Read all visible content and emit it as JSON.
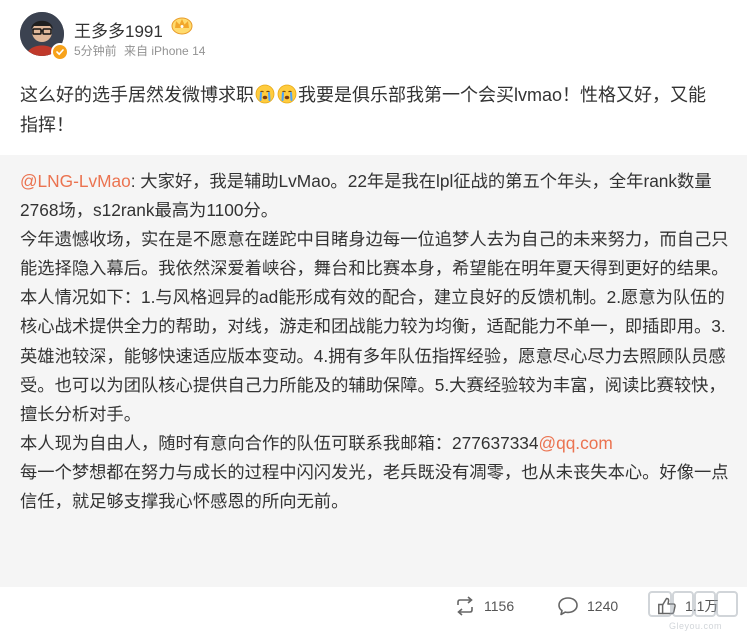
{
  "post": {
    "username": "王多多1991",
    "time": "5分钟前",
    "source": "来自 iPhone 14",
    "text_part1": "这么好的选手居然发微博求职",
    "emoji_name": "crying-face-icon",
    "text_part2": "我要是俱乐部我第一个会买lvmao！性格又好，又能指挥！"
  },
  "repost": {
    "mention": "@LNG-LvMao",
    "p1_text": ": 大家好，我是辅助LvMao。22年是我在lpl征战的第五个年头，全年rank数量2768场，s12rank最高为1100分。",
    "p2": "今年遗憾收场，实在是不愿意在蹉跎中目睹身边每一位追梦人去为自己的未来努力，而自己只能选择隐入幕后。我依然深爱着峡谷，舞台和比赛本身，希望能在明年夏天得到更好的结果。",
    "p3": "本人情况如下：1.与风格迥异的ad能形成有效的配合，建立良好的反馈机制。2.愿意为队伍的核心战术提供全力的帮助，对线，游走和团战能力较为均衡，适配能力不单一，即插即用。3.英雄池较深，能够快速适应版本变动。4.拥有多年队伍指挥经验，愿意尽心尽力去照顾队员感受。也可以为团队核心提供自己力所能及的辅助保障。5.大赛经验较为丰富，阅读比赛较快，擅长分析对手。",
    "p4_text": "本人现为自由人，随时有意向合作的队伍可联系我邮箱：277637334",
    "p4_link": "@qq.com",
    "p5": "每一个梦想都在努力与成长的过程中闪闪发光，老兵既没有凋零，也从未丧失本心。好像一点信任，就足够支撑我心怀感恩的所向无前。"
  },
  "actions": {
    "repost_count": "1156",
    "comment_count": "1240",
    "like_count": "1.1万"
  },
  "watermark": {
    "text": "Gleyou.com"
  },
  "colors": {
    "accent": "#eb7350",
    "repost_bg": "#f5f5f5",
    "text": "#333333",
    "meta": "#939393",
    "verify": "#f7a21b"
  }
}
